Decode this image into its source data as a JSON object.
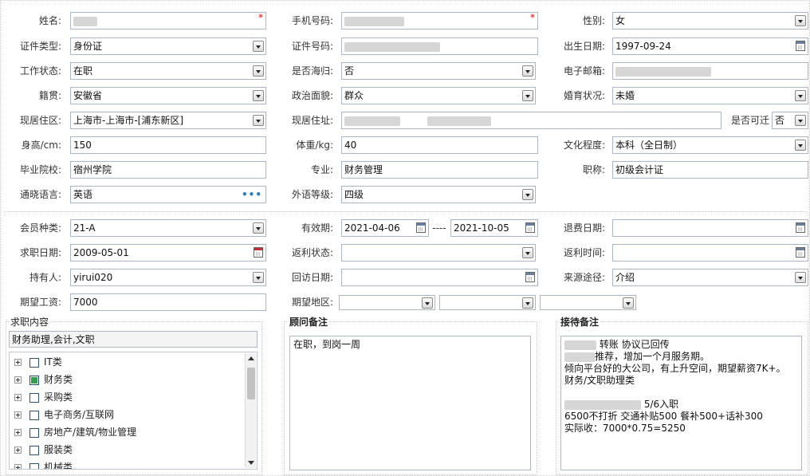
{
  "basic": {
    "name_label": "姓名:",
    "phone_label": "手机号码:",
    "gender_label": "性别:",
    "gender_value": "女",
    "idtype_label": "证件类型:",
    "idtype_value": "身份证",
    "idno_label": "证件号码:",
    "birth_label": "出生日期:",
    "birth_value": "1997-09-24",
    "work_label": "工作状态:",
    "work_value": "在职",
    "overseas_label": "是否海归:",
    "overseas_value": "否",
    "email_label": "电子邮箱:",
    "native_label": "籍贯:",
    "native_value": "安徽省",
    "political_label": "政治面貌:",
    "political_value": "群众",
    "marital_label": "婚育状况:",
    "marital_value": "未婚",
    "area_label": "现居住区:",
    "area_value": "上海市-上海市-[浦东新区]",
    "address_label": "现居住址:",
    "relocate_label": "是否可迁",
    "relocate_value": "否",
    "height_label": "身高/cm:",
    "height_value": "150",
    "weight_label": "体重/kg:",
    "weight_value": "40",
    "edu_label": "文化程度:",
    "edu_value": "本科（全日制）",
    "school_label": "毕业院校:",
    "school_value": "宿州学院",
    "major_label": "专业:",
    "major_value": "财务管理",
    "title_label": "职称:",
    "title_value": "初级会计证",
    "lang_label": "通晓语言:",
    "lang_value": "英语",
    "lang_more": "•••",
    "langlevel_label": "外语等级:",
    "langlevel_value": "四级"
  },
  "member": {
    "type_label": "会员种类:",
    "type_value": "21-A",
    "valid_label": "有效期:",
    "valid_from": "2021-04-06",
    "valid_sep": "----",
    "valid_to": "2021-10-05",
    "refund_label": "退费日期:",
    "jobdate_label": "求职日期:",
    "jobdate_value": "2009-05-01",
    "rebate_status_label": "返利状态:",
    "rebate_time_label": "返利时间:",
    "holder_label": "持有人:",
    "holder_value": "yirui020",
    "visit_label": "回访日期:",
    "source_label": "来源途径:",
    "source_value": "介绍",
    "salary_label": "期望工资:",
    "salary_value": "7000",
    "region_label": "期望地区:"
  },
  "panels": {
    "job_title": "求职内容",
    "job_value": "财务助理,会计,文职",
    "tree": [
      {
        "label": "IT类",
        "checked": false
      },
      {
        "label": "财务类",
        "checked": true
      },
      {
        "label": "采购类",
        "checked": false
      },
      {
        "label": "电子商务/互联网",
        "checked": false
      },
      {
        "label": "房地产/建筑/物业管理",
        "checked": false
      },
      {
        "label": "服装类",
        "checked": false
      },
      {
        "label": "机械类",
        "checked": false
      }
    ],
    "advisor_title": "顾问备注",
    "advisor_text": "在职，到岗一周",
    "reception_title": "接待备注",
    "reception_line1": "转账   协议已回传",
    "reception_line2": "推荐，增加一个月服务期。",
    "reception_line3": "倾向平台好的大公司，有上升空间，期望薪资7K+。",
    "reception_line4": "财务/文职助理类",
    "reception_line5": "5/6入职",
    "reception_line6": "6500不打折  交通补贴500   餐补500+话补300",
    "reception_line7": "实际收：7000*0.75=5250"
  },
  "icons": {
    "required": "*",
    "select": "chevron-down-icon",
    "calendar": "calendar-icon"
  }
}
